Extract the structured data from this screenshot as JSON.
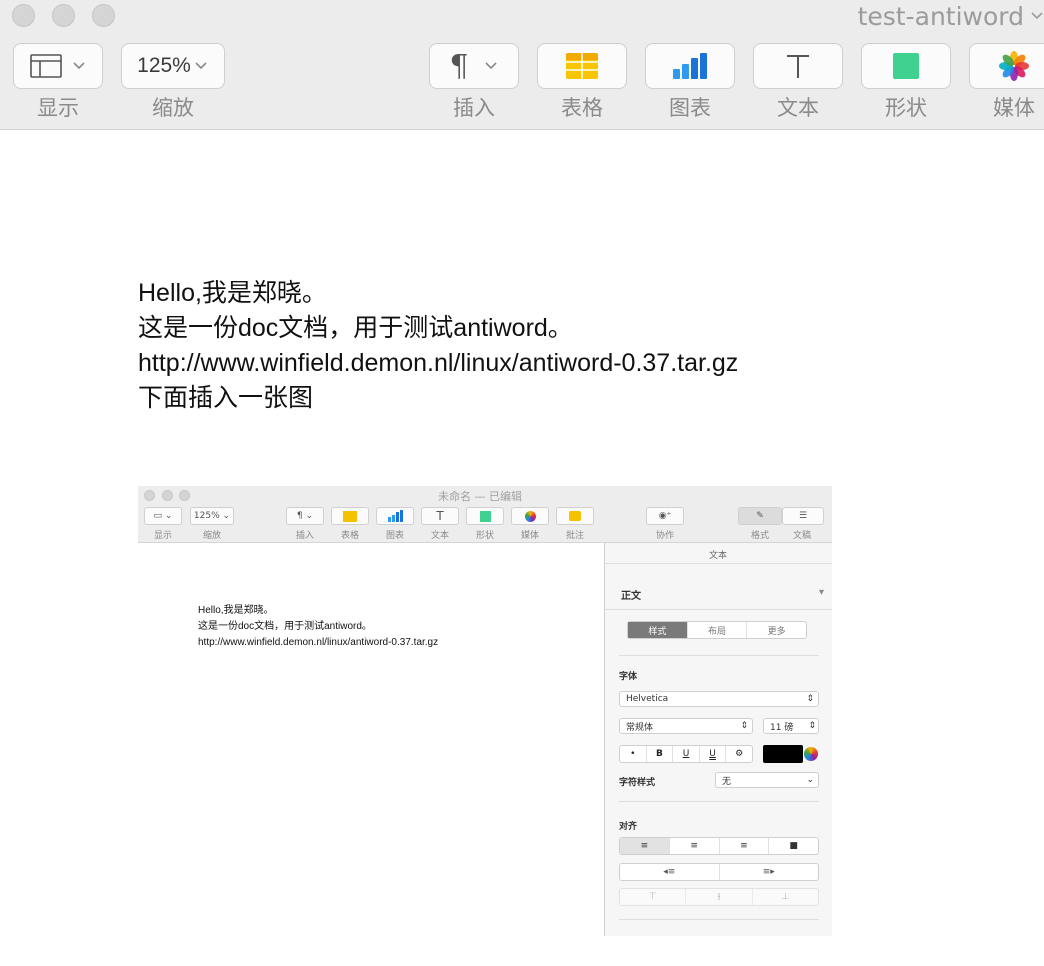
{
  "window": {
    "title": "test-antiword"
  },
  "toolbar": {
    "view_label": "显示",
    "zoom_value": "125%",
    "zoom_label": "缩放",
    "insert_label": "插入",
    "table_label": "表格",
    "chart_label": "图表",
    "text_label": "文本",
    "shape_label": "形状",
    "media_label": "媒体"
  },
  "document": {
    "lines": [
      "Hello,我是郑晓。",
      "这是一份doc文档，用于测试antiword。",
      "http://www.winfield.demon.nl/linux/antiword-0.37.tar.gz",
      "下面插入一张图"
    ]
  },
  "embedded": {
    "title": "未命名 — 已编辑",
    "toolbar": {
      "view_label": "显示",
      "zoom_value": "125%",
      "zoom_label": "缩放",
      "insert_label": "插入",
      "table_label": "表格",
      "chart_label": "图表",
      "text_label": "文本",
      "shape_label": "形状",
      "media_label": "媒体",
      "comment_label": "批注",
      "collab_label": "协作",
      "format_label": "格式",
      "document_label": "文稿"
    },
    "doc_lines": [
      "Hello,我是郑晓。",
      "这是一份doc文档，用于测试antiword。",
      "http://www.winfield.demon.nl/linux/antiword-0.37.tar.gz"
    ],
    "panel": {
      "header": "文本",
      "paragraph_style": "正文",
      "tabs": [
        "样式",
        "布局",
        "更多"
      ],
      "font_section": "字体",
      "font_family": "Helvetica",
      "font_style": "常规体",
      "font_size": "11 磅",
      "char_style_label": "字符样式",
      "char_style_value": "无",
      "align_section": "对齐",
      "format_buttons": [
        "•",
        "B",
        "U",
        "U",
        "⚙"
      ]
    }
  }
}
